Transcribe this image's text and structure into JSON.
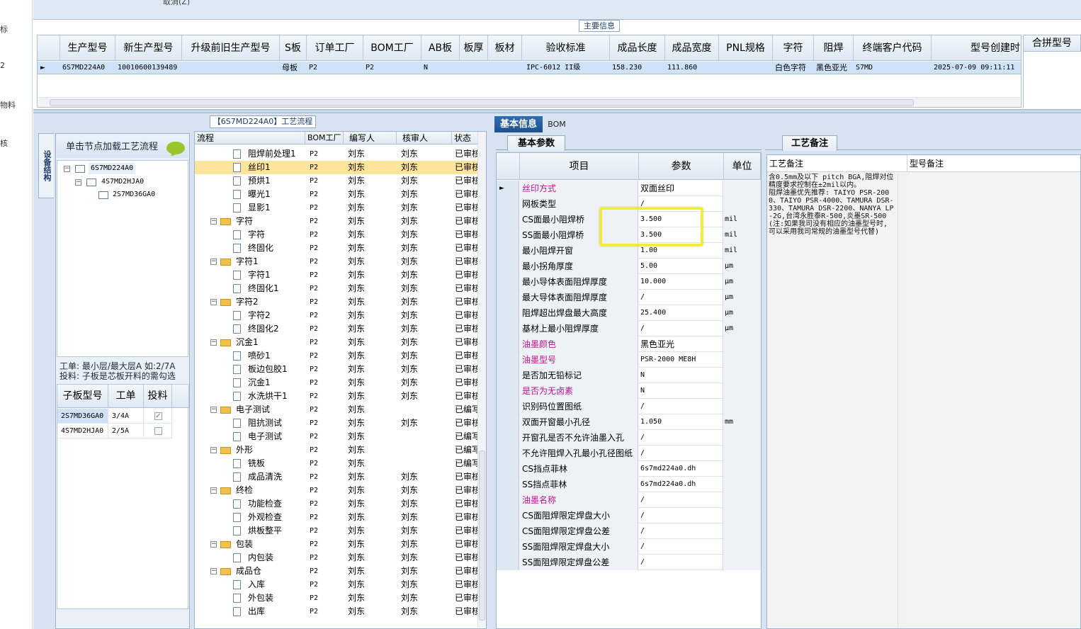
{
  "left_strip": [
    "标",
    "2",
    "物料",
    "核"
  ],
  "top": {
    "cancel_hint": "取消(Z)",
    "main_info_label": "主要信息"
  },
  "main_grid": {
    "headers": [
      "生产型号",
      "新生产型号",
      "升级前旧生产型号",
      "S板",
      "订单工厂",
      "BOM工厂",
      "AB板",
      "板厚",
      "板材",
      "验收标准",
      "成品长度",
      "成品宽度",
      "PNL规格",
      "字符",
      "阻焊",
      "终端客户代码",
      "型号创建时"
    ],
    "row": [
      "6S7MD224A0",
      "10010600139489",
      "",
      "母板",
      "P2",
      "P2",
      "N",
      "",
      "",
      "IPC-6012 II级",
      "158.230",
      "111.860",
      "",
      "白色字符",
      "黑色亚光",
      "S7MD",
      "2025-07-09 09:11:11"
    ],
    "merge_header": "合拼型号"
  },
  "left_panel": {
    "vertical_tab": "设备结构",
    "load_button": "单击节点加载工艺流程",
    "tree": [
      "6S7MD224A0",
      "4S7MD2HJA0",
      "2S7MD36GA0"
    ],
    "hint_line1": "工单: 最小层/最大层A 如:2/7A",
    "hint_line2": "投料: 子板是芯板开料的需勾选",
    "sub_headers": [
      "子板型号",
      "工单",
      "投料"
    ],
    "sub_rows": [
      {
        "model": "2S7MD36GA0",
        "order": "3/4A",
        "checked": "✓"
      },
      {
        "model": "4S7MD2HJA0",
        "order": "2/5A",
        "checked": ""
      }
    ]
  },
  "flow": {
    "tab": "【6S7MD224A0】工艺流程",
    "headers": [
      "流程",
      "BOM工厂",
      "编写人",
      "核审人",
      "状态"
    ],
    "rows": [
      {
        "name": "阻焊前处理1",
        "type": "doc",
        "bom": "P2",
        "writer": "刘东",
        "checker": "刘东",
        "status": "已审核"
      },
      {
        "name": "丝印1",
        "type": "doc",
        "bom": "P2",
        "writer": "刘东",
        "checker": "刘东",
        "status": "已审核"
      },
      {
        "name": "预烘1",
        "type": "doc",
        "bom": "P2",
        "writer": "刘东",
        "checker": "刘东",
        "status": "已审核"
      },
      {
        "name": "曝光1",
        "type": "doc",
        "bom": "P2",
        "writer": "刘东",
        "checker": "刘东",
        "status": "已审核"
      },
      {
        "name": "显影1",
        "type": "doc",
        "bom": "P2",
        "writer": "刘东",
        "checker": "刘东",
        "status": "已审核"
      },
      {
        "name": "字符",
        "type": "folder",
        "bom": "P2",
        "writer": "刘东",
        "checker": "刘东",
        "status": "已审核"
      },
      {
        "name": "字符",
        "type": "doc",
        "bom": "P2",
        "writer": "刘东",
        "checker": "刘东",
        "status": "已审核"
      },
      {
        "name": "终固化",
        "type": "doc",
        "bom": "P2",
        "writer": "刘东",
        "checker": "刘东",
        "status": "已审核"
      },
      {
        "name": "字符1",
        "type": "folder",
        "bom": "P2",
        "writer": "刘东",
        "checker": "刘东",
        "status": "已审核"
      },
      {
        "name": "字符1",
        "type": "doc",
        "bom": "P2",
        "writer": "刘东",
        "checker": "刘东",
        "status": "已审核"
      },
      {
        "name": "终固化1",
        "type": "doc",
        "bom": "P2",
        "writer": "刘东",
        "checker": "刘东",
        "status": "已审核"
      },
      {
        "name": "字符2",
        "type": "folder",
        "bom": "P2",
        "writer": "刘东",
        "checker": "刘东",
        "status": "已审核"
      },
      {
        "name": "字符2",
        "type": "doc",
        "bom": "P2",
        "writer": "刘东",
        "checker": "刘东",
        "status": "已审核"
      },
      {
        "name": "终固化2",
        "type": "doc",
        "bom": "P2",
        "writer": "刘东",
        "checker": "刘东",
        "status": "已审核"
      },
      {
        "name": "沉金1",
        "type": "folder",
        "bom": "P2",
        "writer": "刘东",
        "checker": "刘东",
        "status": "已审核"
      },
      {
        "name": "喷砂1",
        "type": "doc",
        "bom": "P2",
        "writer": "刘东",
        "checker": "刘东",
        "status": "已审核"
      },
      {
        "name": "板边包胶1",
        "type": "doc",
        "bom": "P2",
        "writer": "刘东",
        "checker": "刘东",
        "status": "已审核"
      },
      {
        "name": "沉金1",
        "type": "doc",
        "bom": "P2",
        "writer": "刘东",
        "checker": "刘东",
        "status": "已审核"
      },
      {
        "name": "水洗烘干1",
        "type": "doc",
        "bom": "P2",
        "writer": "刘东",
        "checker": "刘东",
        "status": "已审核"
      },
      {
        "name": "电子测试",
        "type": "folder",
        "bom": "P2",
        "writer": "刘东",
        "checker": "",
        "status": "已编写"
      },
      {
        "name": "阻抗测试",
        "type": "doc",
        "bom": "P2",
        "writer": "刘东",
        "checker": "刘东",
        "status": "已审核"
      },
      {
        "name": "电子测试",
        "type": "doc",
        "bom": "P2",
        "writer": "刘东",
        "checker": "",
        "status": "已编写"
      },
      {
        "name": "外形",
        "type": "folder",
        "bom": "P2",
        "writer": "刘东",
        "checker": "",
        "status": "已编写"
      },
      {
        "name": "铣板",
        "type": "doc",
        "bom": "P2",
        "writer": "刘东",
        "checker": "",
        "status": "已编写"
      },
      {
        "name": "成品清洗",
        "type": "doc",
        "bom": "P2",
        "writer": "刘东",
        "checker": "刘东",
        "status": "已审核"
      },
      {
        "name": "终检",
        "type": "folder",
        "bom": "P2",
        "writer": "刘东",
        "checker": "刘东",
        "status": "已审核"
      },
      {
        "name": "功能检查",
        "type": "doc",
        "bom": "P2",
        "writer": "刘东",
        "checker": "刘东",
        "status": "已审核"
      },
      {
        "name": "外观检查",
        "type": "doc",
        "bom": "P2",
        "writer": "刘东",
        "checker": "刘东",
        "status": "已审核"
      },
      {
        "name": "烘板整平",
        "type": "doc",
        "bom": "P2",
        "writer": "刘东",
        "checker": "刘东",
        "status": "已审核"
      },
      {
        "name": "包装",
        "type": "folder",
        "bom": "P2",
        "writer": "刘东",
        "checker": "刘东",
        "status": "已审核"
      },
      {
        "name": "内包装",
        "type": "doc",
        "bom": "P2",
        "writer": "刘东",
        "checker": "刘东",
        "status": "已审核"
      },
      {
        "name": "成品仓",
        "type": "folder",
        "bom": "P2",
        "writer": "刘东",
        "checker": "刘东",
        "status": "已审核"
      },
      {
        "name": "入库",
        "type": "doc",
        "bom": "P2",
        "writer": "刘东",
        "checker": "刘东",
        "status": "已审核"
      },
      {
        "name": "外包装",
        "type": "doc",
        "bom": "P2",
        "writer": "刘东",
        "checker": "刘东",
        "status": "已审核"
      },
      {
        "name": "出库",
        "type": "doc",
        "bom": "P2",
        "writer": "刘东",
        "checker": "刘东",
        "status": "已审核"
      }
    ]
  },
  "basic": {
    "tabs": [
      "基本信息",
      "BOM"
    ],
    "subtab": "基本参数",
    "headers": [
      "项目",
      "参数",
      "单位"
    ],
    "rows": [
      {
        "k": "丝印方式",
        "v": "双面丝印",
        "u": "",
        "hl": true,
        "cn": true
      },
      {
        "k": "网板类型",
        "v": "/",
        "u": "",
        "hl": false,
        "cn": false
      },
      {
        "k": "CS面最小阻焊桥",
        "v": "3.500",
        "u": "mil",
        "hl": false,
        "cn": false
      },
      {
        "k": "SS面最小阻焊桥",
        "v": "3.500",
        "u": "mil",
        "hl": false,
        "cn": false
      },
      {
        "k": "最小阻焊开窗",
        "v": "1.00",
        "u": "mil",
        "hl": false,
        "cn": false
      },
      {
        "k": "最小拐角厚度",
        "v": "5.00",
        "u": "μm",
        "hl": false,
        "cn": false
      },
      {
        "k": "最小导体表面阻焊厚度",
        "v": "10.000",
        "u": "μm",
        "hl": false,
        "cn": false
      },
      {
        "k": "最大导体表面阻焊厚度",
        "v": "/",
        "u": "μm",
        "hl": false,
        "cn": false
      },
      {
        "k": "阻焊超出焊盘最大高度",
        "v": "25.400",
        "u": "μm",
        "hl": false,
        "cn": false
      },
      {
        "k": "基材上最小阻焊厚度",
        "v": "/",
        "u": "μm",
        "hl": false,
        "cn": false
      },
      {
        "k": "油墨颜色",
        "v": "黑色亚光",
        "u": "",
        "hl": true,
        "cn": true
      },
      {
        "k": "油墨型号",
        "v": "PSR-2000 ME8H",
        "u": "",
        "hl": true,
        "cn": false
      },
      {
        "k": "是否加无铅标记",
        "v": "N",
        "u": "",
        "hl": false,
        "cn": false
      },
      {
        "k": "是否为无卤素",
        "v": "N",
        "u": "",
        "hl": true,
        "cn": false
      },
      {
        "k": "识别码位置图纸",
        "v": "/",
        "u": "",
        "hl": false,
        "cn": false
      },
      {
        "k": "双面开窗最小孔径",
        "v": "1.050",
        "u": "mm",
        "hl": false,
        "cn": false
      },
      {
        "k": "开窗孔是否不允许油墨入孔",
        "v": "/",
        "u": "",
        "hl": false,
        "cn": false
      },
      {
        "k": "不允许阻焊入孔最小孔径图纸",
        "v": "/",
        "u": "",
        "hl": false,
        "cn": false
      },
      {
        "k": "CS挡点菲林",
        "v": "6s7md224a0.dh",
        "u": "",
        "hl": false,
        "cn": false
      },
      {
        "k": "SS挡点菲林",
        "v": "6s7md224a0.dh",
        "u": "",
        "hl": false,
        "cn": false
      },
      {
        "k": "油墨名称",
        "v": "/",
        "u": "",
        "hl": true,
        "cn": false
      },
      {
        "k": "CS面阻焊限定焊盘大小",
        "v": "/",
        "u": "",
        "hl": false,
        "cn": false
      },
      {
        "k": "CS面阻焊限定焊盘公差",
        "v": "/",
        "u": "",
        "hl": false,
        "cn": false
      },
      {
        "k": "SS面阻焊限定焊盘大小",
        "v": "/",
        "u": "",
        "hl": false,
        "cn": false
      },
      {
        "k": "SS面阻焊限定焊盘公差",
        "v": "/",
        "u": "",
        "hl": false,
        "cn": false
      }
    ]
  },
  "notes": {
    "tab": "工艺备注",
    "col1": "工艺备注",
    "col2": "型号备注",
    "text": "含0.5mm及以下 pitch BGA,阻焊对位精度要求控制在±2mil以内。\n阻焊油墨优先推荐: TAIYO PSR-2000、TAIYO PSR-4000、TAMURA DSR-330、TAMURA DSR-2200、NANYA LP-2G,台湾永胜泰R-500,炎墨SR-500(注:如果我司没有相应的油墨型号时,可以采用我司常规的油墨型号代替)"
  }
}
